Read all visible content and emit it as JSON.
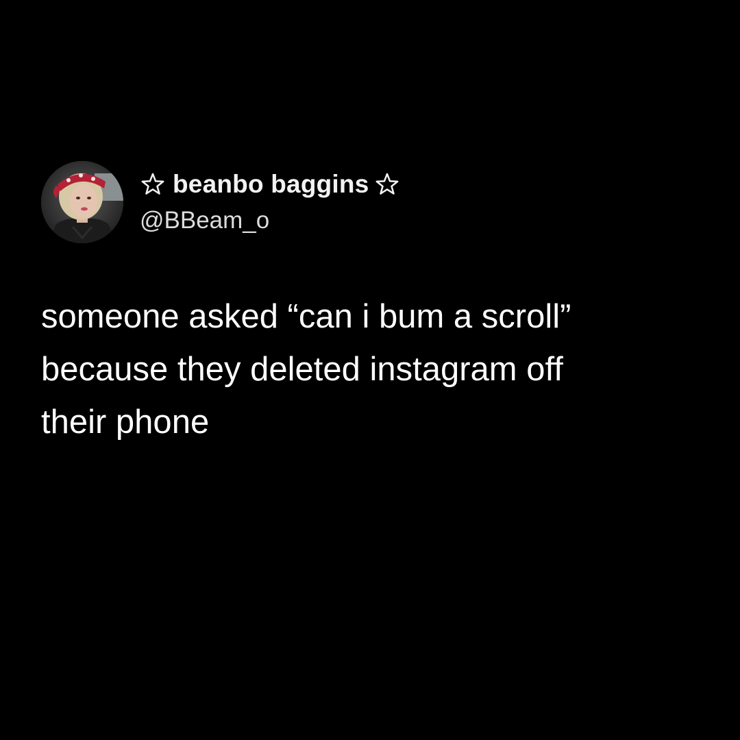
{
  "tweet": {
    "author": {
      "display_name": "beanbo baggins",
      "name_icons": [
        "star-outline-icon",
        "star-outline-icon"
      ],
      "handle": "@BBeam_o",
      "avatar": "profile-photo"
    },
    "body_lines": [
      "someone asked “can i bum a scroll”",
      "because they deleted instagram off",
      "their phone"
    ]
  },
  "colors": {
    "background": "#000000",
    "text": "#ffffff",
    "handle": "#dcdcdc"
  }
}
